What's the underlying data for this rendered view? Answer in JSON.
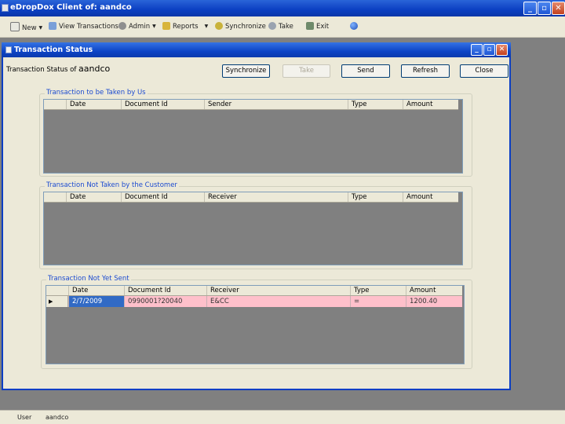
{
  "app": {
    "title": "eDropDox Client of: aandco",
    "controls": {
      "minimize": "_",
      "maximize": "▫",
      "close": "✕"
    }
  },
  "toolbar": {
    "items": [
      {
        "label": "New",
        "icon": "new-icon",
        "dropdown": true
      },
      {
        "label": "View Transactions",
        "icon": "view-icon",
        "dropdown": false
      },
      {
        "label": "Admin",
        "icon": "admin-icon",
        "dropdown": true
      },
      {
        "label": "Reports",
        "icon": "reports-icon",
        "dropdown": true
      },
      {
        "label": "Synchronize",
        "icon": "synchronize-icon",
        "dropdown": false
      },
      {
        "label": "Take",
        "icon": "take-icon",
        "dropdown": false
      },
      {
        "label": "Exit",
        "icon": "exit-icon",
        "dropdown": false
      },
      {
        "label": "",
        "icon": "globe-icon",
        "dropdown": false
      }
    ]
  },
  "child_window": {
    "title": "Transaction Status",
    "heading_prefix": "Transaction Status of",
    "heading_user": "aandco",
    "buttons": {
      "synchronize": "Synchronize",
      "take": "Take",
      "send": "Send",
      "refresh": "Refresh",
      "close": "Close"
    },
    "groups": {
      "taken_by_us": {
        "title": "Transaction to be Taken by Us",
        "columns": [
          "Date",
          "Document Id",
          "Sender",
          "Type",
          "Amount"
        ],
        "rows": []
      },
      "not_taken_by_customer": {
        "title": "Transaction Not Taken by the Customer",
        "columns": [
          "Date",
          "Document Id",
          "Receiver",
          "Type",
          "Amount"
        ],
        "rows": []
      },
      "not_yet_sent": {
        "title": "Transaction Not Yet Sent",
        "columns": [
          "Date",
          "Document Id",
          "Receiver",
          "Type",
          "Amount"
        ],
        "rows": [
          {
            "indicator": "▶",
            "date": "2/7/2009",
            "document_id": "0990001?20040",
            "receiver": "E&CC",
            "type": "=",
            "amount": "1200.40"
          }
        ]
      }
    }
  },
  "status_bar": {
    "label": "User",
    "value": "aandco"
  },
  "colors": {
    "title_bar": "#0b3fc2",
    "window_bg": "#ece9d8",
    "grid_bg": "#808080",
    "pending_row": "#ffc0cb",
    "selected_cell": "#316ac5",
    "group_title": "#1c4bd0"
  }
}
